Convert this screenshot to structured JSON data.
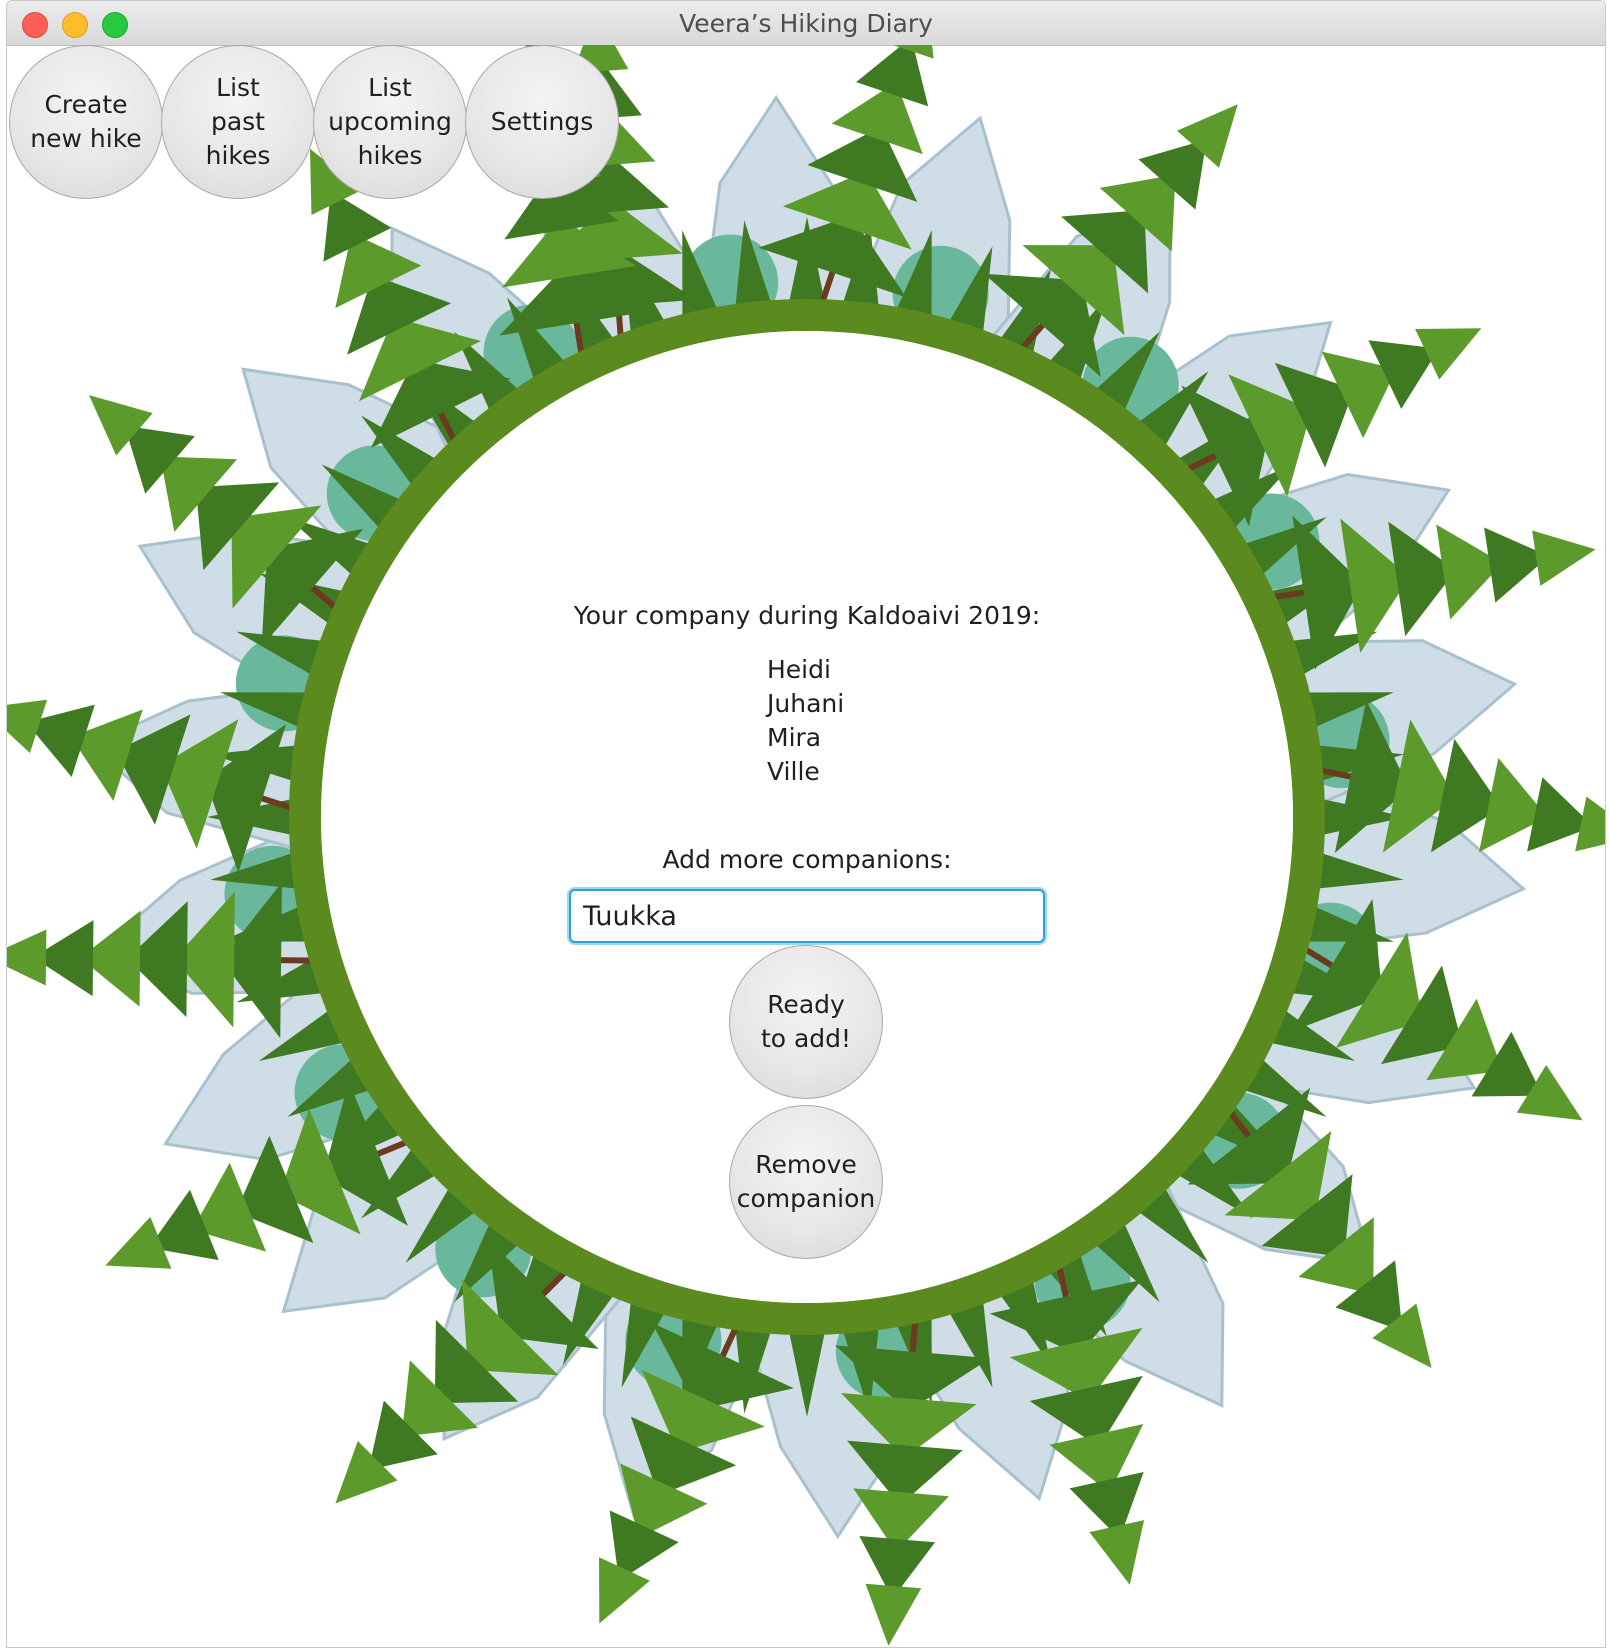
{
  "window": {
    "title": "Veera’s Hiking Diary"
  },
  "toolbar": {
    "create_label": "Create\nnew hike",
    "past_label": "List\npast\nhikes",
    "upcoming_label": "List\nupcoming\nhikes",
    "settings_label": "Settings"
  },
  "main": {
    "company_heading": "Your company during Kaldoaivi 2019:",
    "companions": [
      "Heidi",
      "Juhani",
      "Mira",
      "Ville"
    ],
    "add_label": "Add more companions:",
    "input_value": "Tuukka",
    "ready_label": "Ready\nto add!",
    "remove_label": "Remove\ncompanion"
  },
  "colors": {
    "ring": "#5b8a1f",
    "tree": "#3f7a22",
    "tree_light": "#5d9a2c",
    "trunk": "#6b3b1f",
    "mountain": "#cfdde6",
    "mountain_shadow": "#a9c1cf",
    "teal": "#6ab89b"
  }
}
